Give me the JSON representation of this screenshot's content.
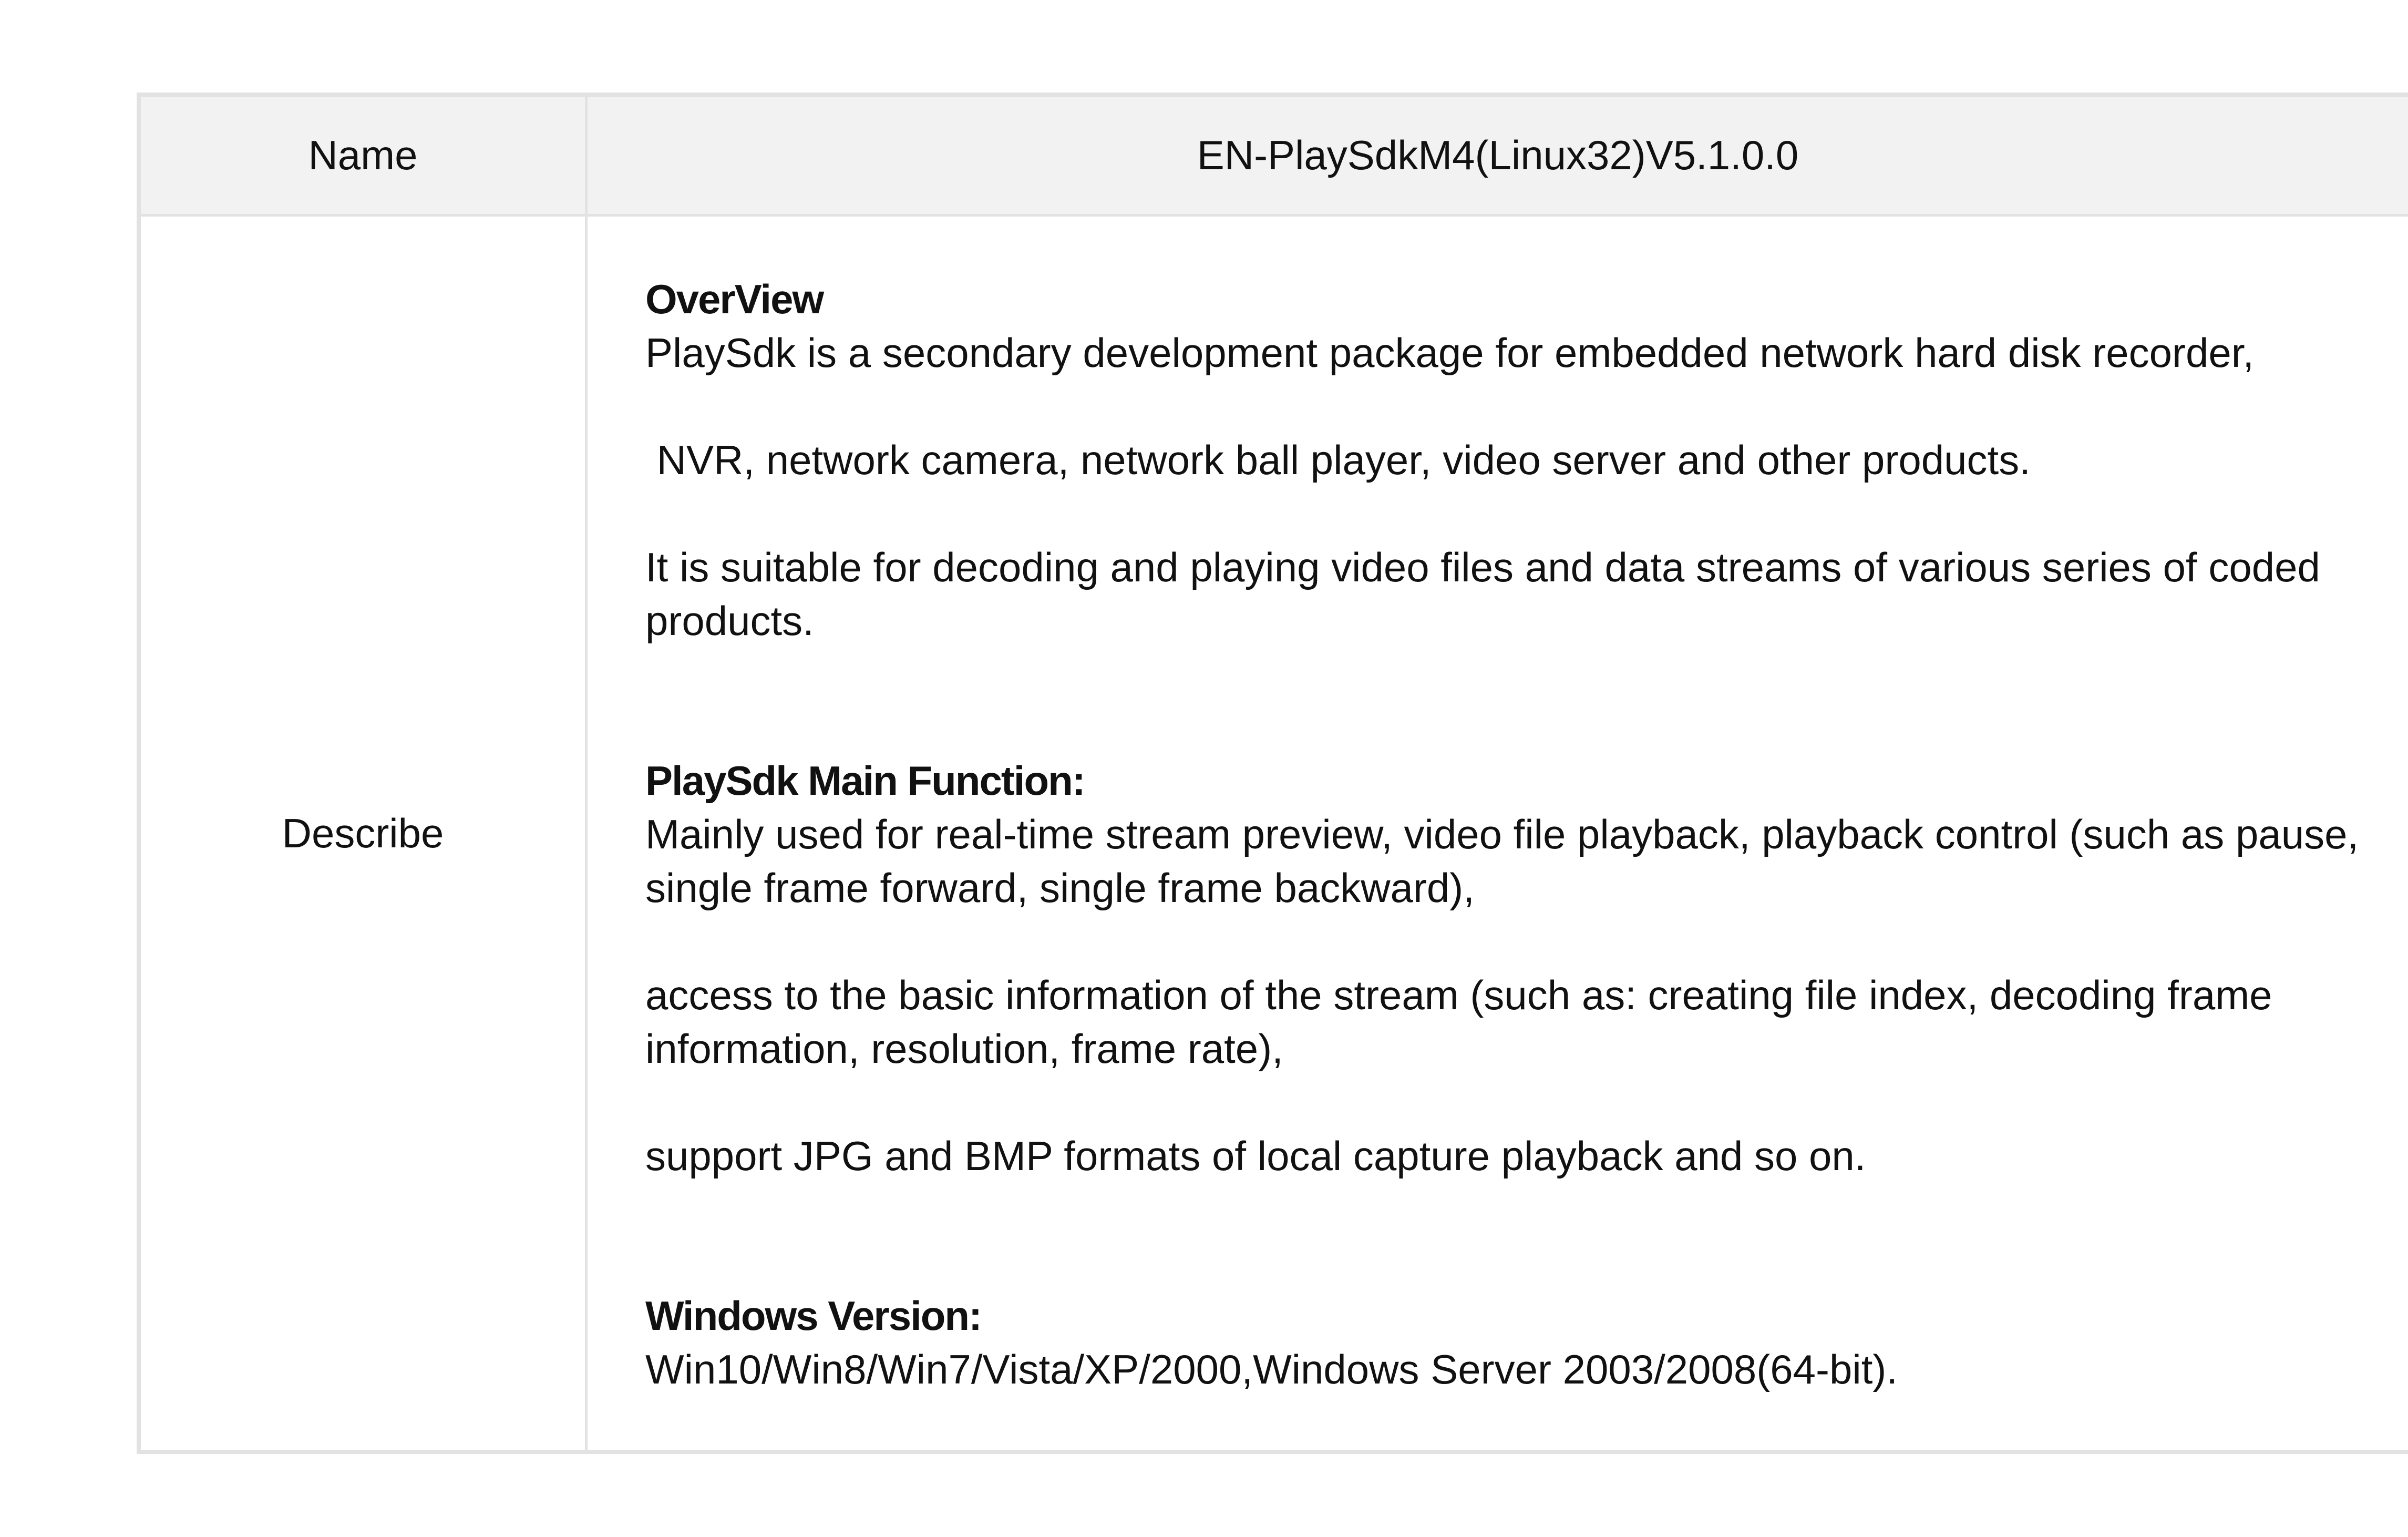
{
  "table": {
    "name_label": "Name",
    "name_value": "EN-PlaySdkM4(Linux32)V5.1.0.0",
    "describe_label": "Describe"
  },
  "description": {
    "overview": {
      "title": "OverView",
      "paragraphs": [
        "PlaySdk is a secondary development package for embedded network hard disk recorder,",
        " NVR, network camera, network ball player, video server and other products.",
        "It is suitable for decoding and playing video files and data streams of various series of coded products."
      ]
    },
    "main_function": {
      "title": "PlaySdk Main Function:",
      "paragraphs": [
        "Mainly used for real-time stream preview, video file playback, playback control (such as pause, single frame forward, single frame backward),",
        "access to the basic information of the stream (such as: creating file index, decoding frame information, resolution, frame rate),",
        "support JPG and BMP formats of local capture playback and so on."
      ]
    },
    "windows_version": {
      "title": "Windows Version:",
      "paragraphs": [
        "Win10/Win8/Win7/Vista/XP/2000,Windows Server 2003/2008(64-bit)."
      ]
    }
  }
}
